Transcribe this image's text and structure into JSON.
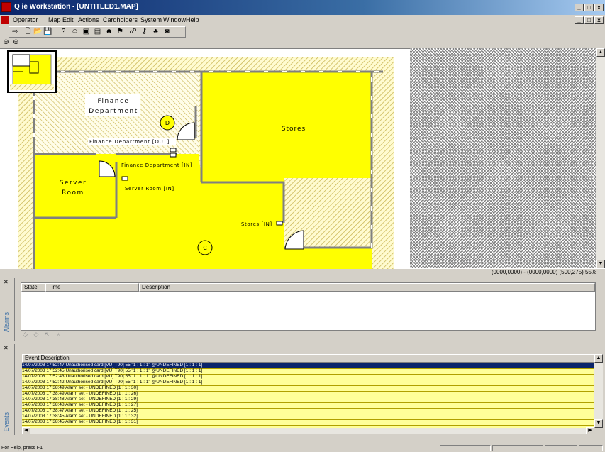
{
  "window": {
    "title": "Q ie Workstation - [UNTITLED1.MAP]",
    "min_btn": "_",
    "max_btn": "□",
    "close_btn": "x"
  },
  "menu": [
    "Operator",
    "Map",
    "Edit",
    "Actions",
    "Cardholders",
    "System",
    "Window",
    "Help"
  ],
  "map": {
    "rooms": [
      {
        "name": "Finance\nDepartment"
      },
      {
        "name": "Stores"
      },
      {
        "name": "Server\nRoom"
      }
    ],
    "doors": [
      "Finance Department [OUT]",
      "Finance Department [IN]",
      "Server Room [IN]",
      "Stores [IN]"
    ],
    "markers": [
      "D",
      "C"
    ],
    "colors": {
      "room": "#ffff00",
      "hatch": "#c8b450",
      "wall": "#808080"
    }
  },
  "coords": "(0000,0000) - (0000,0000) (500,275) 55%",
  "alarms": {
    "tab": "Alarms",
    "columns": [
      "State",
      "Time",
      "Description"
    ]
  },
  "events": {
    "tab": "Events",
    "column": "Event Description",
    "rows": [
      "14/07/2003 17:52:47 Unauthorised card [VU] T90] 55  \"1 : 1 : 1\"  @UNDEFINED [1 : 1 : 1]",
      "14/07/2003 17:52:45 Unauthorised card [VU] T90] 55  \"1 : 1 : 1\"  @UNDEFINED [1 : 1 : 1]",
      "14/07/2003 17:52:43 Unauthorised card [VU] T90] 55  \"1 : 1 : 1\"  @UNDEFINED [1 : 1 : 1]",
      "14/07/2003 17:52:42 Unauthorised card [VU] T90] 55  \"1 : 1 : 1\"  @UNDEFINED [1 : 1 : 1]",
      "14/07/2003 17:38:49 Alarm set - UNDEFINED [1 : 1 : 30]",
      "14/07/2003 17:38:49 Alarm set - UNDEFINED [1 : 1 : 26]",
      "14/07/2003 17:38:48 Alarm set - UNDEFINED [1 : 1 : 29]",
      "14/07/2003 17:38:48 Alarm set - UNDEFINED [1 : 1 : 27]",
      "14/07/2003 17:38:47 Alarm set - UNDEFINED [1 : 1 : 25]",
      "14/07/2003 17:38:45 Alarm set - UNDEFINED [1 : 1 : 32]",
      "14/07/2003 17:38:45 Alarm set - UNDEFINED [1 : 1 : 31]"
    ]
  },
  "status": {
    "help": "For Help, press F1"
  }
}
